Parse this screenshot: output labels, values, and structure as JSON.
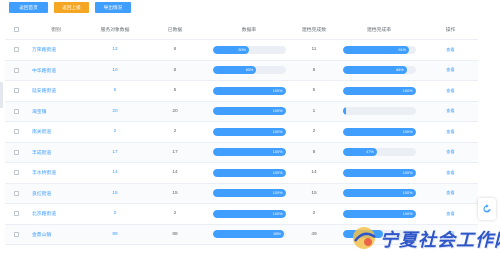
{
  "toolbar": {
    "back_home": "返回首页",
    "back_up": "返回上级",
    "export": "导出情况"
  },
  "table": {
    "headers": {
      "street": "街别",
      "service": "服务对象数据",
      "done": "已数据",
      "rate": "数据率",
      "archive": "建档完成数",
      "archive_rate": "建档完成率",
      "op": "操作"
    },
    "rows": [
      {
        "street": "万荣路街道",
        "service": "12",
        "done": "6",
        "rate_label": "50%",
        "rate": 50,
        "archive": "11",
        "archive_rate_label": "91%",
        "archive_rate": 91,
        "op": "查看"
      },
      {
        "street": "中华路街道",
        "service": "10",
        "done": "6",
        "rate_label": "60%",
        "rate": 60,
        "archive": "8",
        "archive_rate_label": "88%",
        "archive_rate": 88,
        "op": "查看"
      },
      {
        "street": "延安路街道",
        "service": "5",
        "done": "5",
        "rate_label": "100%",
        "rate": 100,
        "archive": "5",
        "archive_rate_label": "100%",
        "archive_rate": 100,
        "op": "查看"
      },
      {
        "street": "海宝镇",
        "service": "20",
        "done": "20",
        "rate_label": "100%",
        "rate": 100,
        "archive": "1",
        "archive_rate_label": "",
        "archive_rate": 5,
        "op": "查看"
      },
      {
        "street": "南关街道",
        "service": "2",
        "done": "2",
        "rate_label": "100%",
        "rate": 100,
        "archive": "2",
        "archive_rate_label": "100%",
        "archive_rate": 100,
        "op": "查看"
      },
      {
        "street": "丰成街道",
        "service": "17",
        "done": "17",
        "rate_label": "100%",
        "rate": 100,
        "archive": "8",
        "archive_rate_label": "47%",
        "archive_rate": 47,
        "op": "查看"
      },
      {
        "street": "丰水桥街道",
        "service": "14",
        "done": "14",
        "rate_label": "100%",
        "rate": 100,
        "archive": "14",
        "archive_rate_label": "100%",
        "archive_rate": 100,
        "op": "查看"
      },
      {
        "street": "良红街道",
        "service": "15",
        "done": "15",
        "rate_label": "100%",
        "rate": 100,
        "archive": "15",
        "archive_rate_label": "100%",
        "archive_rate": 100,
        "op": "查看"
      },
      {
        "street": "北京路街道",
        "service": "2",
        "done": "2",
        "rate_label": "100%",
        "rate": 100,
        "archive": "2",
        "archive_rate_label": "100%",
        "archive_rate": 100,
        "op": "查看"
      },
      {
        "street": "金鼎山镇",
        "service": "89",
        "done": "88",
        "rate_label": "98%",
        "rate": 98,
        "archive": "49",
        "archive_rate_label": "",
        "archive_rate": 55,
        "op": "查看"
      }
    ]
  },
  "watermark": {
    "text": "宁夏社会工作网"
  },
  "colors": {
    "primary": "#409eff",
    "warning": "#f5a623",
    "bar_track": "#ebeef5",
    "watermark": "#2f56c8"
  }
}
